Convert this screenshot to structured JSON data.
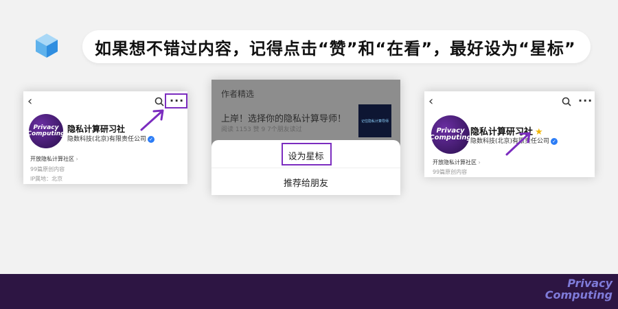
{
  "banner": {
    "text": "如果想不错过内容，记得点击“赞”和“在看”，最好设为“星标”"
  },
  "profile_card": {
    "name": "隐私计算研习社",
    "company": "隐数科技(北京)有限责任公司",
    "community": "开放隐私计算社区",
    "community_arrow": "›",
    "original_count": "99篇原创内容",
    "ip_location": "IP属地：北京",
    "back_icon": "‹",
    "more_icon": "···",
    "avatar_line1": "Privacy",
    "avatar_line2": "Computing"
  },
  "middle_card": {
    "section_title": "作者精选",
    "article_title": "上岸！选择你的隐私计算导师！",
    "article_stats": "阅读 1153  赞 9  7个朋友读过",
    "thumb_text": "记住隐私计算导师",
    "menu_star": "设为星标",
    "menu_recommend": "推荐给朋友"
  },
  "brand": {
    "line1": "Privacy",
    "line2": "Computing"
  },
  "colors": {
    "accent_purple": "#7b2cbf",
    "band": "#2d1543",
    "verify_blue": "#2b7cf6",
    "star_gold": "#f2b705"
  }
}
